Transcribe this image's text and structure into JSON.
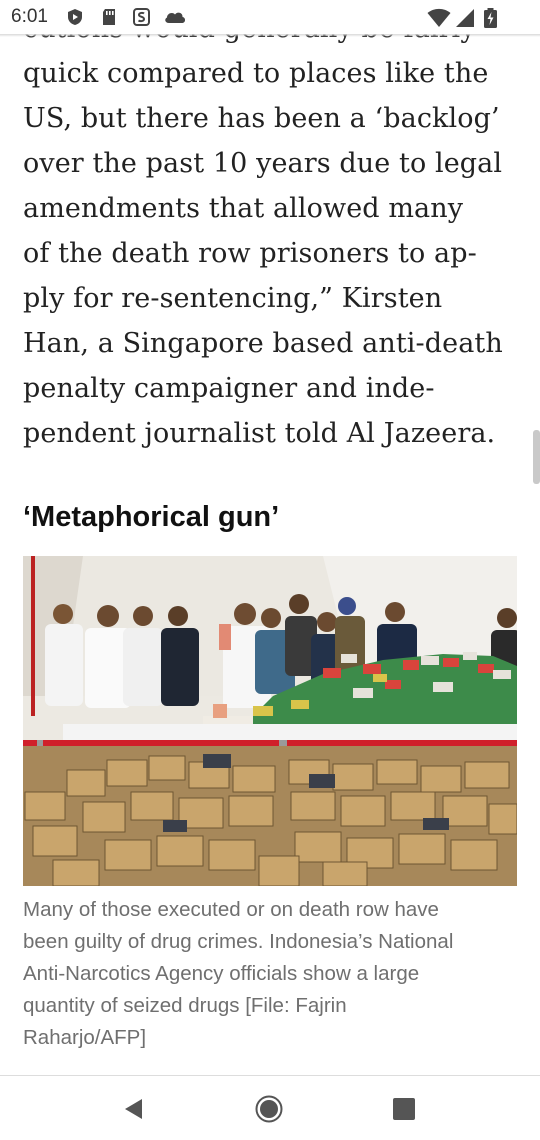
{
  "status_bar": {
    "time": "6:01",
    "icons": [
      "shield-play-icon",
      "sd-card-icon",
      "sim-s-icon",
      "cloud-icon",
      "wifi-icon",
      "cell-signal-icon",
      "battery-icon"
    ]
  },
  "article": {
    "paragraph_lines": [
      "cutions would generally be fairly",
      "quick compared to places like the",
      "US, but there has been a ‘backlog’",
      "over the past 10 years due to legal",
      "amendments that allowed many",
      "of the death row prisoners to ap-",
      "ply for re-sentencing,”  Kirsten",
      "Han, a Singapore based anti-death",
      "penalty campaigner and inde-",
      "pendent journalist told Al Jazeera."
    ],
    "heading": "‘Metaphorical gun’",
    "caption_lines": [
      "Many of those executed or on death row have",
      "been guilty of drug crimes. Indonesia’s National",
      "Anti-Narcotics Agency officials show a large",
      "quantity of seized drugs [File: Fajrin",
      "Raharjo/AFP]"
    ]
  },
  "nav_bar": {
    "icons": [
      "back-icon",
      "home-icon",
      "recents-icon"
    ]
  },
  "colors": {
    "body_text": "#222222",
    "caption_text": "#6f6f6f",
    "nav_icon": "#555555"
  }
}
